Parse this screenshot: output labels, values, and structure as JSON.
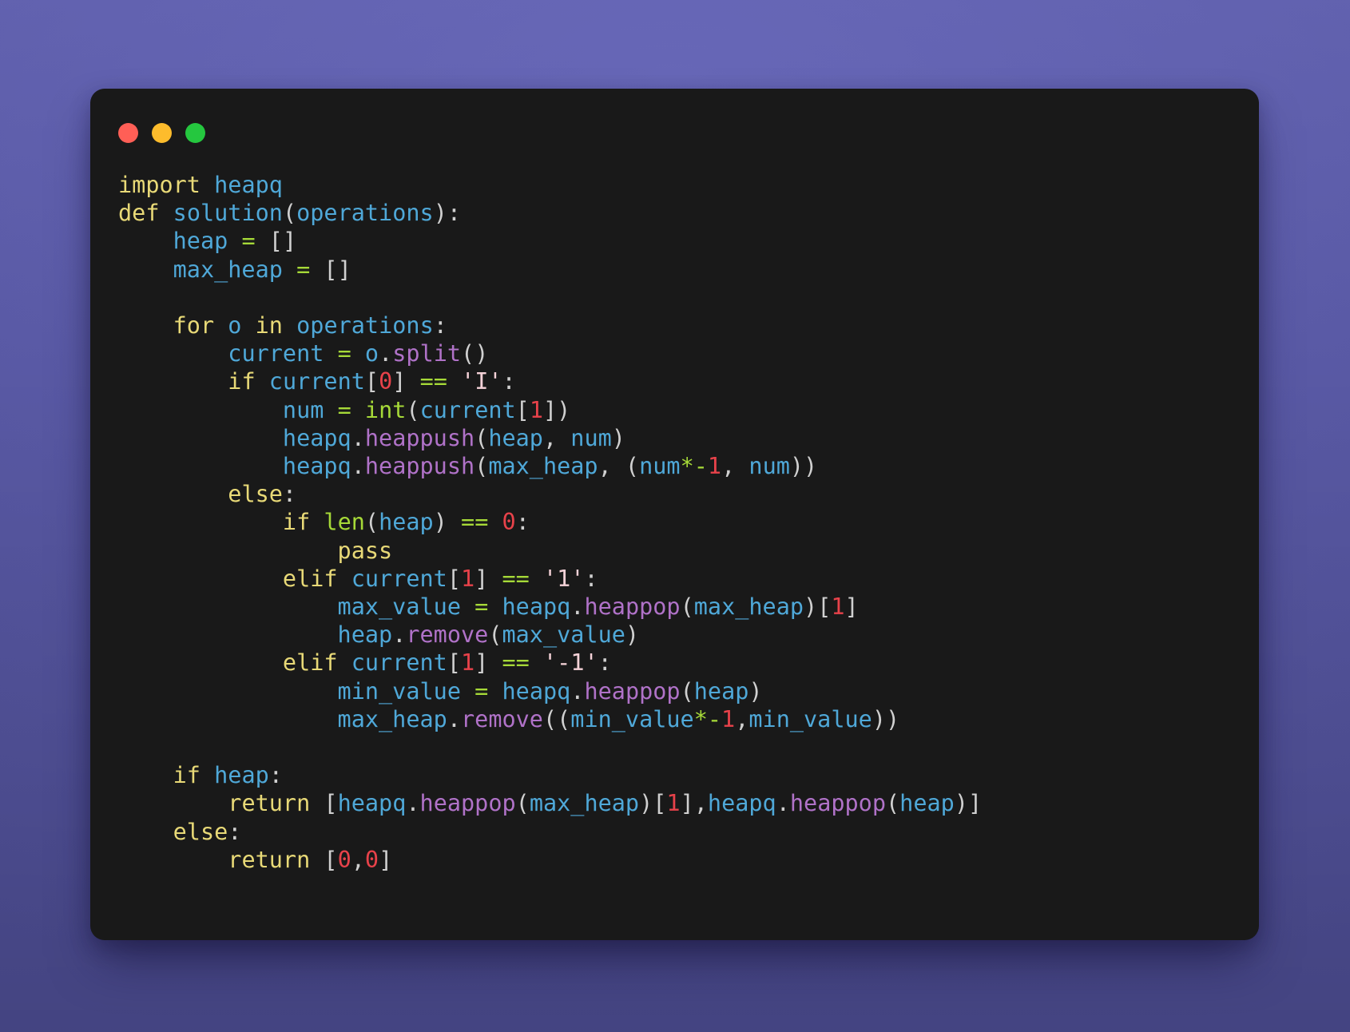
{
  "window": {
    "background_color": "#5c5ca9",
    "surface_color": "#191919",
    "traffic_lights": [
      {
        "name": "close",
        "color": "#ff5f56"
      },
      {
        "name": "minimize",
        "color": "#fdbc2c"
      },
      {
        "name": "maximize",
        "color": "#25c73f"
      }
    ]
  },
  "palette": {
    "keyword": "#e8d977",
    "name": "#4fa8d8",
    "function": "#b072c8",
    "builtin": "#a6d938",
    "operator": "#a6d938",
    "number": "#e8424a",
    "string": "#f5d2d8",
    "punctuation": "#d0d0d0",
    "foreground": "#d8d8d8"
  },
  "code": {
    "language": "python",
    "text": "import heapq\ndef solution(operations):\n    heap = []\n    max_heap = []\n\n    for o in operations:\n        current = o.split()\n        if current[0] == 'I':\n            num = int(current[1])\n            heapq.heappush(heap, num)\n            heapq.heappush(max_heap, (num*-1, num))\n        else:\n            if len(heap) == 0:\n                pass\n            elif current[1] == '1':\n                max_value = heapq.heappop(max_heap)[1]\n                heap.remove(max_value)\n            elif current[1] == '-1':\n                min_value = heapq.heappop(heap)\n                max_heap.remove((min_value*-1,min_value))\n\n    if heap:\n        return [heapq.heappop(max_heap)[1],heapq.heappop(heap)]\n    else:\n        return [0,0]",
    "lines": [
      "import heapq",
      "def solution(operations):",
      "    heap = []",
      "    max_heap = []",
      "",
      "    for o in operations:",
      "        current = o.split()",
      "        if current[0] == 'I':",
      "            num = int(current[1])",
      "            heapq.heappush(heap, num)",
      "            heapq.heappush(max_heap, (num*-1, num))",
      "        else:",
      "            if len(heap) == 0:",
      "                pass",
      "            elif current[1] == '1':",
      "                max_value = heapq.heappop(max_heap)[1]",
      "                heap.remove(max_value)",
      "            elif current[1] == '-1':",
      "                min_value = heapq.heappop(heap)",
      "                max_heap.remove((min_value*-1,min_value))",
      "",
      "    if heap:",
      "        return [heapq.heappop(max_heap)[1],heapq.heappop(heap)]",
      "    else:",
      "        return [0,0]"
    ],
    "tokens": [
      [
        [
          "kw",
          "import"
        ],
        [
          "pun",
          " "
        ],
        [
          "nam",
          "heapq"
        ]
      ],
      [
        [
          "kw",
          "def"
        ],
        [
          "pun",
          " "
        ],
        [
          "nam",
          "solution"
        ],
        [
          "pun",
          "("
        ],
        [
          "nam",
          "operations"
        ],
        [
          "pun",
          "):"
        ]
      ],
      [
        [
          "pun",
          "    "
        ],
        [
          "nam",
          "heap"
        ],
        [
          "pun",
          " "
        ],
        [
          "op",
          "="
        ],
        [
          "pun",
          " []"
        ]
      ],
      [
        [
          "pun",
          "    "
        ],
        [
          "nam",
          "max_heap"
        ],
        [
          "pun",
          " "
        ],
        [
          "op",
          "="
        ],
        [
          "pun",
          " []"
        ]
      ],
      [],
      [
        [
          "pun",
          "    "
        ],
        [
          "kw",
          "for"
        ],
        [
          "pun",
          " "
        ],
        [
          "nam",
          "o"
        ],
        [
          "pun",
          " "
        ],
        [
          "kw",
          "in"
        ],
        [
          "pun",
          " "
        ],
        [
          "nam",
          "operations"
        ],
        [
          "pun",
          ":"
        ]
      ],
      [
        [
          "pun",
          "        "
        ],
        [
          "nam",
          "current"
        ],
        [
          "pun",
          " "
        ],
        [
          "op",
          "="
        ],
        [
          "pun",
          " "
        ],
        [
          "nam",
          "o"
        ],
        [
          "pun",
          "."
        ],
        [
          "fn",
          "split"
        ],
        [
          "pun",
          "()"
        ]
      ],
      [
        [
          "pun",
          "        "
        ],
        [
          "kw",
          "if"
        ],
        [
          "pun",
          " "
        ],
        [
          "nam",
          "current"
        ],
        [
          "pun",
          "["
        ],
        [
          "num",
          "0"
        ],
        [
          "pun",
          "] "
        ],
        [
          "op",
          "=="
        ],
        [
          "pun",
          " "
        ],
        [
          "str",
          "'I'"
        ],
        [
          "pun",
          ":"
        ]
      ],
      [
        [
          "pun",
          "            "
        ],
        [
          "nam",
          "num"
        ],
        [
          "pun",
          " "
        ],
        [
          "op",
          "="
        ],
        [
          "pun",
          " "
        ],
        [
          "bi",
          "int"
        ],
        [
          "pun",
          "("
        ],
        [
          "nam",
          "current"
        ],
        [
          "pun",
          "["
        ],
        [
          "num",
          "1"
        ],
        [
          "pun",
          "])"
        ]
      ],
      [
        [
          "pun",
          "            "
        ],
        [
          "nam",
          "heapq"
        ],
        [
          "pun",
          "."
        ],
        [
          "fn",
          "heappush"
        ],
        [
          "pun",
          "("
        ],
        [
          "nam",
          "heap"
        ],
        [
          "pun",
          ", "
        ],
        [
          "nam",
          "num"
        ],
        [
          "pun",
          ")"
        ]
      ],
      [
        [
          "pun",
          "            "
        ],
        [
          "nam",
          "heapq"
        ],
        [
          "pun",
          "."
        ],
        [
          "fn",
          "heappush"
        ],
        [
          "pun",
          "("
        ],
        [
          "nam",
          "max_heap"
        ],
        [
          "pun",
          ", ("
        ],
        [
          "nam",
          "num"
        ],
        [
          "op",
          "*-"
        ],
        [
          "num",
          "1"
        ],
        [
          "pun",
          ", "
        ],
        [
          "nam",
          "num"
        ],
        [
          "pun",
          "))"
        ]
      ],
      [
        [
          "pun",
          "        "
        ],
        [
          "kw",
          "else"
        ],
        [
          "pun",
          ":"
        ]
      ],
      [
        [
          "pun",
          "            "
        ],
        [
          "kw",
          "if"
        ],
        [
          "pun",
          " "
        ],
        [
          "bi",
          "len"
        ],
        [
          "pun",
          "("
        ],
        [
          "nam",
          "heap"
        ],
        [
          "pun",
          ") "
        ],
        [
          "op",
          "=="
        ],
        [
          "pun",
          " "
        ],
        [
          "num",
          "0"
        ],
        [
          "pun",
          ":"
        ]
      ],
      [
        [
          "pun",
          "                "
        ],
        [
          "kw",
          "pass"
        ]
      ],
      [
        [
          "pun",
          "            "
        ],
        [
          "kw",
          "elif"
        ],
        [
          "pun",
          " "
        ],
        [
          "nam",
          "current"
        ],
        [
          "pun",
          "["
        ],
        [
          "num",
          "1"
        ],
        [
          "pun",
          "] "
        ],
        [
          "op",
          "=="
        ],
        [
          "pun",
          " "
        ],
        [
          "str",
          "'1'"
        ],
        [
          "pun",
          ":"
        ]
      ],
      [
        [
          "pun",
          "                "
        ],
        [
          "nam",
          "max_value"
        ],
        [
          "pun",
          " "
        ],
        [
          "op",
          "="
        ],
        [
          "pun",
          " "
        ],
        [
          "nam",
          "heapq"
        ],
        [
          "pun",
          "."
        ],
        [
          "fn",
          "heappop"
        ],
        [
          "pun",
          "("
        ],
        [
          "nam",
          "max_heap"
        ],
        [
          "pun",
          ")["
        ],
        [
          "num",
          "1"
        ],
        [
          "pun",
          "]"
        ]
      ],
      [
        [
          "pun",
          "                "
        ],
        [
          "nam",
          "heap"
        ],
        [
          "pun",
          "."
        ],
        [
          "fn",
          "remove"
        ],
        [
          "pun",
          "("
        ],
        [
          "nam",
          "max_value"
        ],
        [
          "pun",
          ")"
        ]
      ],
      [
        [
          "pun",
          "            "
        ],
        [
          "kw",
          "elif"
        ],
        [
          "pun",
          " "
        ],
        [
          "nam",
          "current"
        ],
        [
          "pun",
          "["
        ],
        [
          "num",
          "1"
        ],
        [
          "pun",
          "] "
        ],
        [
          "op",
          "=="
        ],
        [
          "pun",
          " "
        ],
        [
          "str",
          "'-1'"
        ],
        [
          "pun",
          ":"
        ]
      ],
      [
        [
          "pun",
          "                "
        ],
        [
          "nam",
          "min_value"
        ],
        [
          "pun",
          " "
        ],
        [
          "op",
          "="
        ],
        [
          "pun",
          " "
        ],
        [
          "nam",
          "heapq"
        ],
        [
          "pun",
          "."
        ],
        [
          "fn",
          "heappop"
        ],
        [
          "pun",
          "("
        ],
        [
          "nam",
          "heap"
        ],
        [
          "pun",
          ")"
        ]
      ],
      [
        [
          "pun",
          "                "
        ],
        [
          "nam",
          "max_heap"
        ],
        [
          "pun",
          "."
        ],
        [
          "fn",
          "remove"
        ],
        [
          "pun",
          "(("
        ],
        [
          "nam",
          "min_value"
        ],
        [
          "op",
          "*-"
        ],
        [
          "num",
          "1"
        ],
        [
          "pun",
          ","
        ],
        [
          "nam",
          "min_value"
        ],
        [
          "pun",
          "))"
        ]
      ],
      [],
      [
        [
          "pun",
          "    "
        ],
        [
          "kw",
          "if"
        ],
        [
          "pun",
          " "
        ],
        [
          "nam",
          "heap"
        ],
        [
          "pun",
          ":"
        ]
      ],
      [
        [
          "pun",
          "        "
        ],
        [
          "kw",
          "return"
        ],
        [
          "pun",
          " ["
        ],
        [
          "nam",
          "heapq"
        ],
        [
          "pun",
          "."
        ],
        [
          "fn",
          "heappop"
        ],
        [
          "pun",
          "("
        ],
        [
          "nam",
          "max_heap"
        ],
        [
          "pun",
          ")["
        ],
        [
          "num",
          "1"
        ],
        [
          "pun",
          "],"
        ],
        [
          "nam",
          "heapq"
        ],
        [
          "pun",
          "."
        ],
        [
          "fn",
          "heappop"
        ],
        [
          "pun",
          "("
        ],
        [
          "nam",
          "heap"
        ],
        [
          "pun",
          ")]"
        ]
      ],
      [
        [
          "pun",
          "    "
        ],
        [
          "kw",
          "else"
        ],
        [
          "pun",
          ":"
        ]
      ],
      [
        [
          "pun",
          "        "
        ],
        [
          "kw",
          "return"
        ],
        [
          "pun",
          " ["
        ],
        [
          "num",
          "0"
        ],
        [
          "pun",
          ","
        ],
        [
          "num",
          "0"
        ],
        [
          "pun",
          "]"
        ]
      ]
    ]
  }
}
